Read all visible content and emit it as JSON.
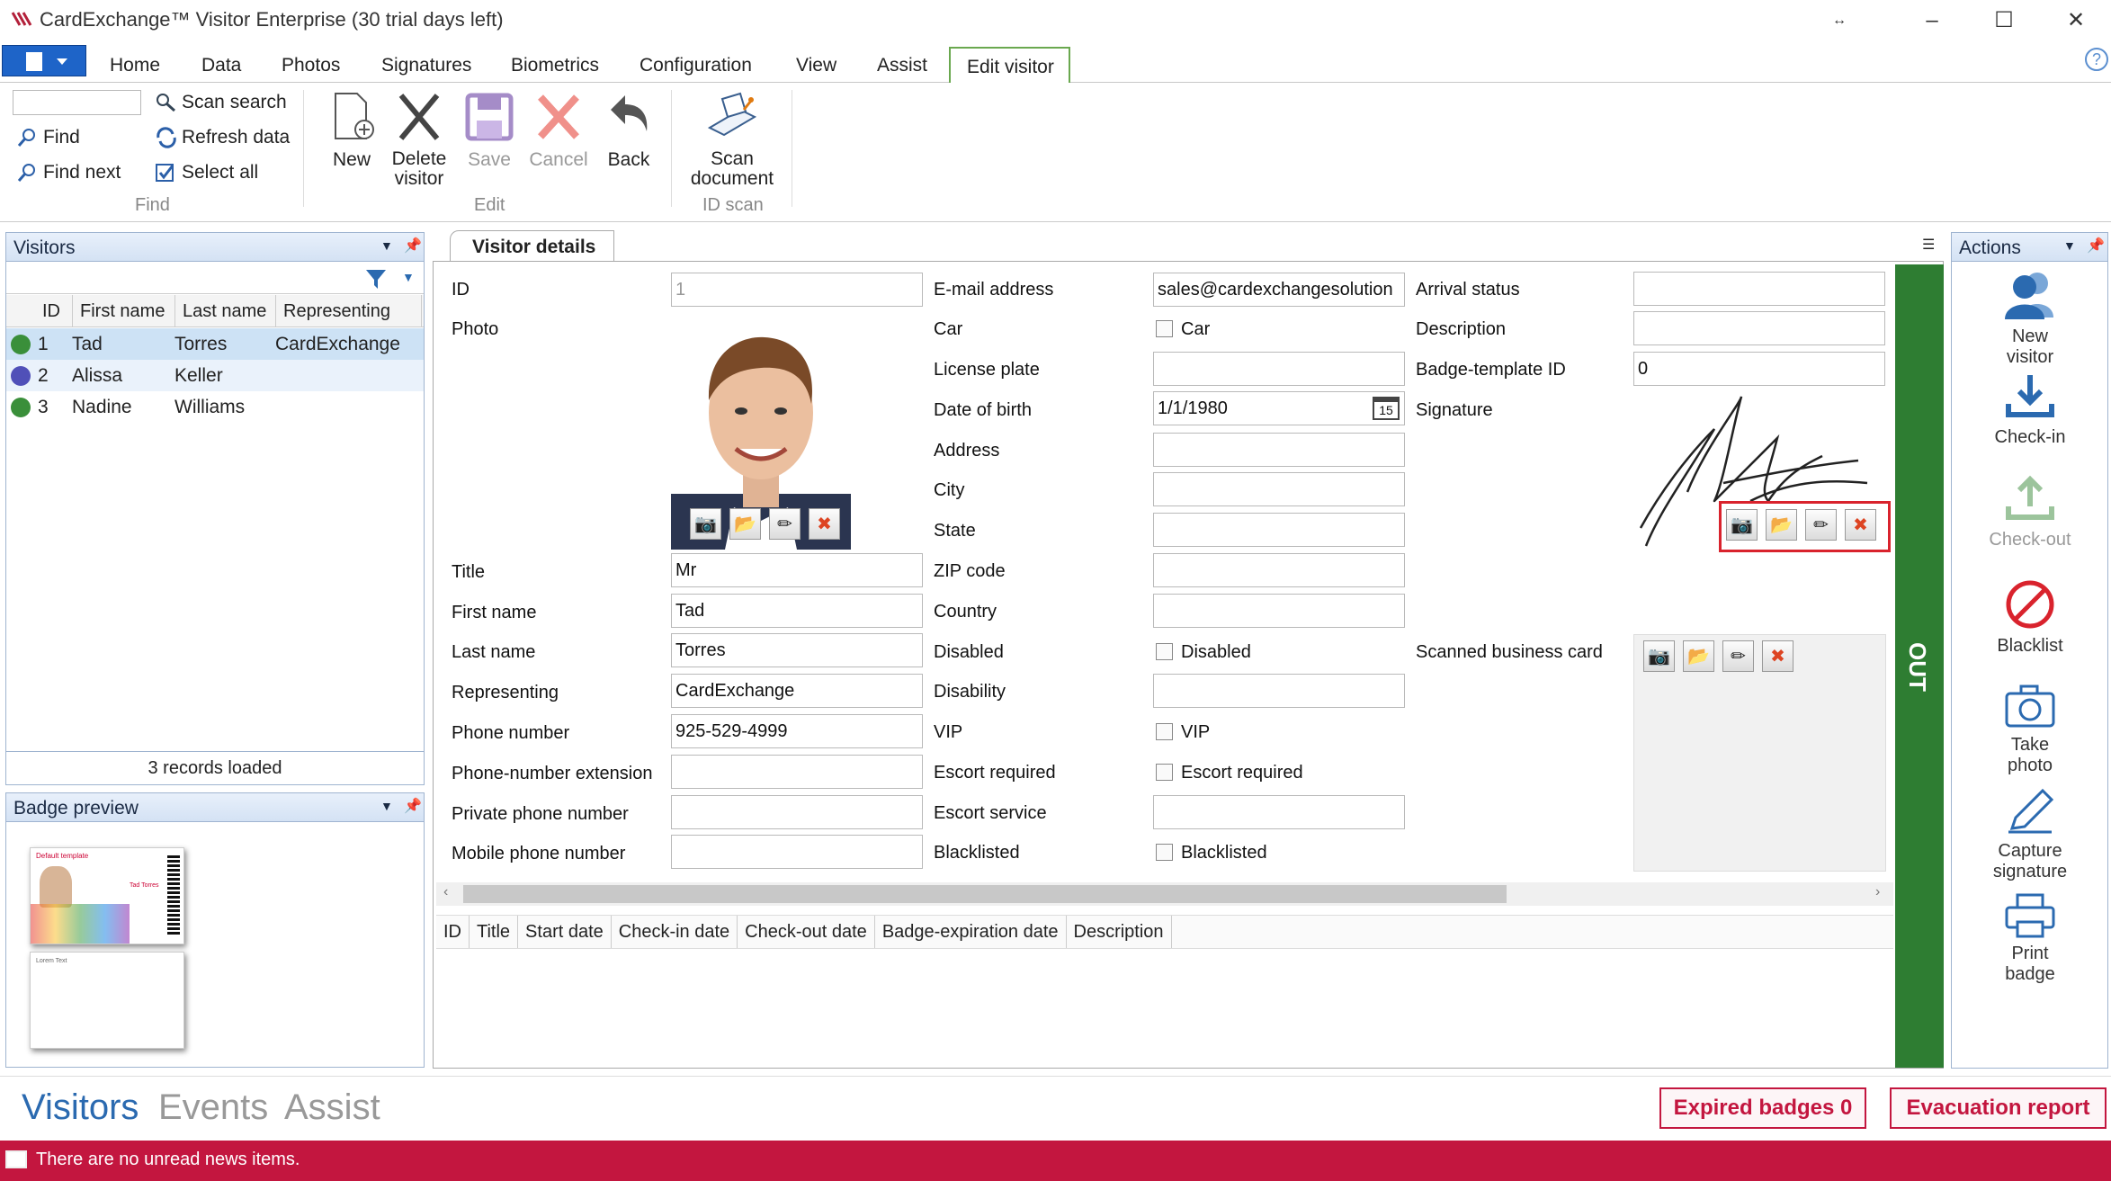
{
  "titlebar": {
    "title": "CardExchange™ Visitor Enterprise (30 trial days left)"
  },
  "menu": {
    "tabs": [
      "Home",
      "Data",
      "Photos",
      "Signatures",
      "Biometrics",
      "Configuration",
      "View",
      "Assist"
    ],
    "active_tab": "Edit visitor"
  },
  "ribbon": {
    "find": {
      "scan_search": "Scan search",
      "find": "Find",
      "refresh": "Refresh data",
      "find_next": "Find next",
      "select_all": "Select all",
      "group": "Find"
    },
    "edit": {
      "new": "New",
      "delete1": "Delete",
      "delete2": "visitor",
      "save": "Save",
      "cancel": "Cancel",
      "back": "Back",
      "group": "Edit"
    },
    "idscan": {
      "scan1": "Scan",
      "scan2": "document",
      "group": "ID scan"
    }
  },
  "visitors_pane": {
    "title": "Visitors",
    "columns": [
      "ID",
      "First name",
      "Last name",
      "Representing"
    ],
    "rows": [
      {
        "id": "1",
        "first": "Tad",
        "last": "Torres",
        "rep": "CardExchange",
        "status_color": "#3a8f3a"
      },
      {
        "id": "2",
        "first": "Alissa",
        "last": "Keller",
        "rep": "",
        "status_color": "#5050b8"
      },
      {
        "id": "3",
        "first": "Nadine",
        "last": "Williams",
        "rep": "",
        "status_color": "#3a8f3a"
      }
    ],
    "footer": "3 records loaded"
  },
  "badge_pane": {
    "title": "Badge preview",
    "template_label": "Default template",
    "name_on_badge": "Tad Torres",
    "back_text": "Lorem Text"
  },
  "details": {
    "tab": "Visitor details",
    "col1": {
      "id": "ID",
      "id_val": "1",
      "photo": "Photo",
      "title": "Title",
      "title_val": "Mr",
      "first": "First name",
      "first_val": "Tad",
      "last": "Last name",
      "last_val": "Torres",
      "rep": "Representing",
      "rep_val": "CardExchange",
      "phone": "Phone number",
      "phone_val": "925-529-4999",
      "ext": "Phone-number extension",
      "private": "Private phone number",
      "mobile": "Mobile phone number"
    },
    "col2": {
      "email": "E-mail address",
      "email_val": "sales@cardexchangesolution",
      "car": "Car",
      "car_cb": "Car",
      "plate": "License plate",
      "dob": "Date of birth",
      "dob_val": "1/1/1980",
      "cal_day": "15",
      "address": "Address",
      "city": "City",
      "state": "State",
      "zip": "ZIP code",
      "country": "Country",
      "disabled": "Disabled",
      "disabled_cb": "Disabled",
      "disability": "Disability",
      "vip": "VIP",
      "vip_cb": "VIP",
      "escort": "Escort required",
      "escort_cb": "Escort required",
      "escort_service": "Escort service",
      "blacklisted": "Blacklisted",
      "blacklisted_cb": "Blacklisted"
    },
    "col3": {
      "arrival": "Arrival status",
      "description": "Description",
      "badge_tpl": "Badge-template ID",
      "badge_tpl_val": "0",
      "signature": "Signature",
      "business_card": "Scanned business card"
    },
    "out_label": "OUT",
    "history_columns": [
      "ID",
      "Title",
      "Start date",
      "Check-in date",
      "Check-out date",
      "Badge-expiration date",
      "Description"
    ]
  },
  "actions": {
    "title": "Actions",
    "new1": "New",
    "new2": "visitor",
    "checkin": "Check-in",
    "checkout": "Check-out",
    "blacklist": "Blacklist",
    "photo1": "Take",
    "photo2": "photo",
    "capture1": "Capture",
    "capture2": "signature",
    "print1": "Print",
    "print2": "badge"
  },
  "bottom": {
    "nav": [
      "Visitors",
      "Events",
      "Assist"
    ],
    "expired": "Expired badges 0",
    "evac": "Evacuation report"
  },
  "news": {
    "text": "There are no unread news items."
  },
  "colors": {
    "accent": "#1e64c8",
    "out_bar": "#2e7d32",
    "news_bar": "#c3163f",
    "highlight": "#d9232d"
  }
}
